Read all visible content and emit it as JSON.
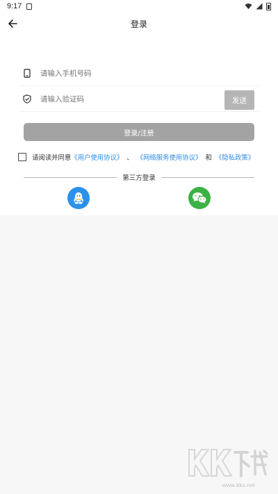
{
  "status_bar": {
    "time": "9:17"
  },
  "header": {
    "title": "登录"
  },
  "form": {
    "phone_placeholder": "请输入手机号码",
    "code_placeholder": "请输入验证码",
    "send_label": "发送",
    "login_label": "登录/注册"
  },
  "agreement": {
    "prefix": "请阅读并同意",
    "user_agreement": "《用户使用协议》",
    "separator": "、",
    "service_agreement": "《网络服务使用协议》",
    "and": "和",
    "privacy_policy": "《隐私政策》"
  },
  "third_party": {
    "label": "第三方登录"
  },
  "watermark": {
    "url": "www.kkx.net"
  },
  "colors": {
    "link": "#2f8ce6",
    "qq": "#2c91e8",
    "wechat": "#3cb145",
    "button_disabled": "#a3a3a3"
  }
}
